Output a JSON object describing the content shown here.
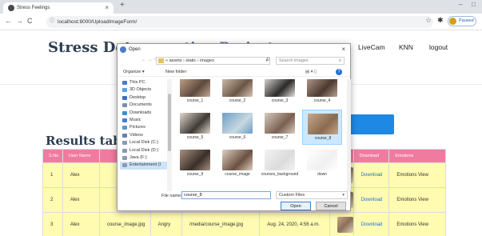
{
  "browser": {
    "tab_title": "Stress Feelings",
    "tab_close": "×",
    "new_tab": "+",
    "url": "localhost:8000/UploadImageForm/",
    "profile_label": "Paused",
    "win_min": "–",
    "win_max": "□"
  },
  "nav": {
    "brand": "Stress Dete",
    "brand_hidden": "ction Project",
    "links": [
      "LiveCam",
      "KNN",
      "logout"
    ]
  },
  "results": {
    "title": "Results tabl",
    "headers": [
      "S.No",
      "User Name",
      "",
      "",
      "",
      "",
      "",
      "Download",
      "Emotions"
    ],
    "rows": [
      {
        "sno": "1",
        "user": "Alex",
        "image": "",
        "emotion": "",
        "path": "",
        "date": "",
        "download": "Download",
        "view": "Emotions View"
      },
      {
        "sno": "2",
        "user": "Alex",
        "image": "",
        "emotion": "",
        "path": "",
        "date": "",
        "download": "Download",
        "view": "Emotions View"
      },
      {
        "sno": "3",
        "user": "Alex",
        "image": "course_image.jpg",
        "emotion": "Angry",
        "path": "/media/course_image.jpg",
        "date": "Aug. 24, 2020, 4:56 a.m.",
        "download": "Download",
        "view": "Emotions View"
      }
    ]
  },
  "dialog": {
    "title": "Open",
    "close": "×",
    "path": "« assets › static › images",
    "search_placeholder": "Search images",
    "organize": "Organize ▾",
    "new_folder": "New folder",
    "sidebar": [
      {
        "label": "This PC",
        "color": "#4a7bd0"
      },
      {
        "label": "3D Objects",
        "color": "#5aa0e0"
      },
      {
        "label": "Desktop",
        "color": "#3b6fc4"
      },
      {
        "label": "Documents",
        "color": "#7d8fa8"
      },
      {
        "label": "Downloads",
        "color": "#3b8fd8"
      },
      {
        "label": "Music",
        "color": "#4b7ad0"
      },
      {
        "label": "Pictures",
        "color": "#5d96c8"
      },
      {
        "label": "Videos",
        "color": "#6a7fa8"
      },
      {
        "label": "Local Disk (C:)",
        "color": "#8a9ab0"
      },
      {
        "label": "Local Disk (D:)",
        "color": "#8a9ab0"
      },
      {
        "label": "Java (F:)",
        "color": "#8a9ab0"
      },
      {
        "label": "Entertainment (I",
        "color": "#8a9ab0"
      }
    ],
    "files": [
      {
        "name": "course_1",
        "c1": "#c8a88e",
        "c2": "#5c4a3e"
      },
      {
        "name": "course_2",
        "c1": "#d9c4b0",
        "c2": "#6a5646"
      },
      {
        "name": "course_3",
        "c1": "#e8e2dc",
        "c2": "#2a2a2a"
      },
      {
        "name": "course_4",
        "c1": "#b8a090",
        "c2": "#4a3a30"
      },
      {
        "name": "course_5",
        "c1": "#e2d8cc",
        "c2": "#3e3a36"
      },
      {
        "name": "course_6",
        "c1": "#6a9ec8",
        "c2": "#c8d8e0"
      },
      {
        "name": "course_7",
        "c1": "#d8ccc0",
        "c2": "#7a6050"
      },
      {
        "name": "course_8",
        "c1": "#c8a88a",
        "c2": "#8a6a50"
      },
      {
        "name": "course_9",
        "c1": "#a89080",
        "c2": "#3a302a"
      },
      {
        "name": "course_image",
        "c1": "#e0d0c0",
        "c2": "#6a5040"
      },
      {
        "name": "courses_background",
        "c1": "#f2f2f2",
        "c2": "#dcdcdc"
      },
      {
        "name": "down",
        "c1": "#ffffff",
        "c2": "#f0f0f0"
      }
    ],
    "selected_file": "course_8",
    "filename_label": "File name:",
    "filename_value": "course_8",
    "filetype": "Custom Files",
    "open_label": "Open",
    "cancel_label": "Cancel"
  }
}
